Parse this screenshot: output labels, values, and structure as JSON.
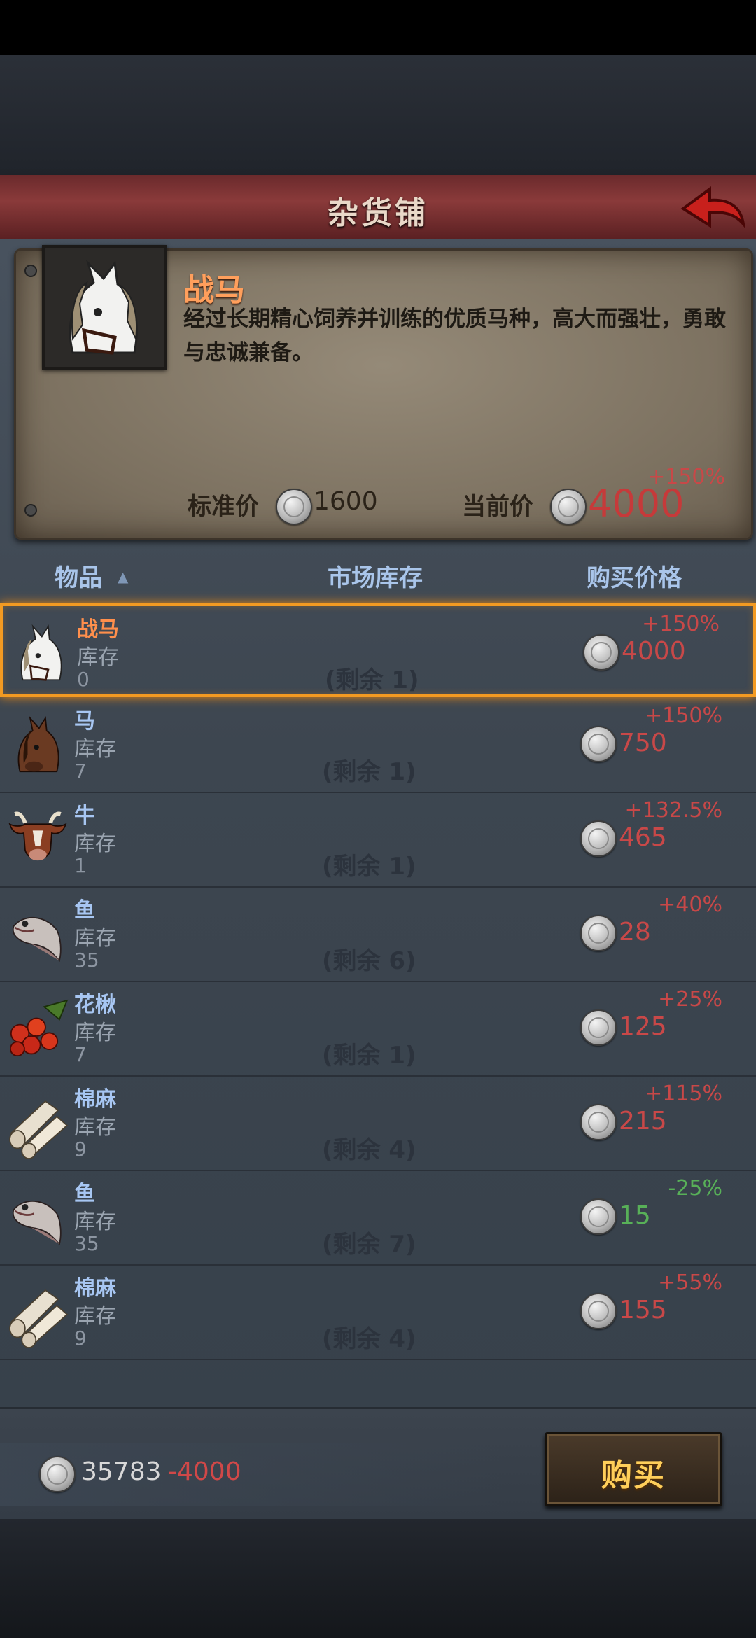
{
  "header": {
    "title": "杂货铺"
  },
  "detail": {
    "name": "战马",
    "description": "经过长期精心饲养并训练的优质马种，高大而强壮，勇敢与忠诚兼备。",
    "std_label": "标准价",
    "std_price": "1600",
    "cur_label": "当前价",
    "cur_price": "4000",
    "cur_pct": "+150%"
  },
  "table": {
    "col_item": "物品",
    "col_stock": "市场库存",
    "col_price": "购买价格",
    "rows": [
      {
        "name": "战马",
        "stock_label": "库存",
        "stock": "0",
        "remain": "(剩余 1)",
        "price": "4000",
        "pct": "+150%",
        "icon": "warhorse-icon",
        "selected": true
      },
      {
        "name": "马",
        "stock_label": "库存",
        "stock": "7",
        "remain": "(剩余 1)",
        "price": "750",
        "pct": "+150%",
        "icon": "horse-icon"
      },
      {
        "name": "牛",
        "stock_label": "库存",
        "stock": "1",
        "remain": "(剩余 1)",
        "price": "465",
        "pct": "+132.5%",
        "icon": "ox-icon"
      },
      {
        "name": "鱼",
        "stock_label": "库存",
        "stock": "35",
        "remain": "(剩余 6)",
        "price": "28",
        "pct": "+40%",
        "icon": "fish-icon"
      },
      {
        "name": "花楸",
        "stock_label": "库存",
        "stock": "7",
        "remain": "(剩余 1)",
        "price": "125",
        "pct": "+25%",
        "icon": "rowan-berry-icon"
      },
      {
        "name": "棉麻",
        "stock_label": "库存",
        "stock": "9",
        "remain": "(剩余 4)",
        "price": "215",
        "pct": "+115%",
        "icon": "cloth-roll-icon"
      },
      {
        "name": "鱼",
        "stock_label": "库存",
        "stock": "35",
        "remain": "(剩余 7)",
        "price": "15",
        "pct": "-25%",
        "icon": "fish-icon",
        "down": true
      },
      {
        "name": "棉麻",
        "stock_label": "库存",
        "stock": "9",
        "remain": "(剩余 4)",
        "price": "155",
        "pct": "+55%",
        "icon": "cloth-roll-icon"
      }
    ]
  },
  "footer": {
    "balance": "35783",
    "delta": "-4000",
    "buy_label": "购买"
  },
  "colors": {
    "price_up": "#c84848",
    "price_down": "#58b058",
    "selected_border": "#f39a22"
  }
}
